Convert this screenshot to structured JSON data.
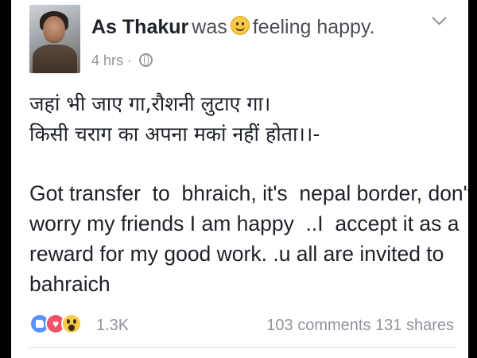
{
  "post": {
    "author": "As Thakur",
    "activity_prefix": "was",
    "activity_feeling": "feeling happy.",
    "timestamp": "4 hrs",
    "separator": "·",
    "privacy_icon": "globe-icon",
    "avatar_icon": "profile-photo",
    "hindi_lines": [
      "जहां भी जाए गा,रौशनी लुटाए गा।",
      "किसी चराग का अपना मकां नहीं होता।।-"
    ],
    "english_lines": [
      "Got transfer  to  bhraich, it's  nepal border, don't",
      "worry my friends I am happy  ..I  accept it as a",
      "reward for my good work. .u all are invited to",
      "bahraich"
    ]
  },
  "footer": {
    "reaction_count": "1.3K",
    "comments": "103 comments",
    "shares": "131 shares",
    "reaction_icons": [
      "like-icon",
      "love-icon",
      "wow-icon"
    ]
  },
  "colors": {
    "text_primary": "#1d2129",
    "text_secondary": "#90949c",
    "like_blue": "#5890ff",
    "love_red": "#f25268",
    "wow_yellow": "#f7c948"
  }
}
